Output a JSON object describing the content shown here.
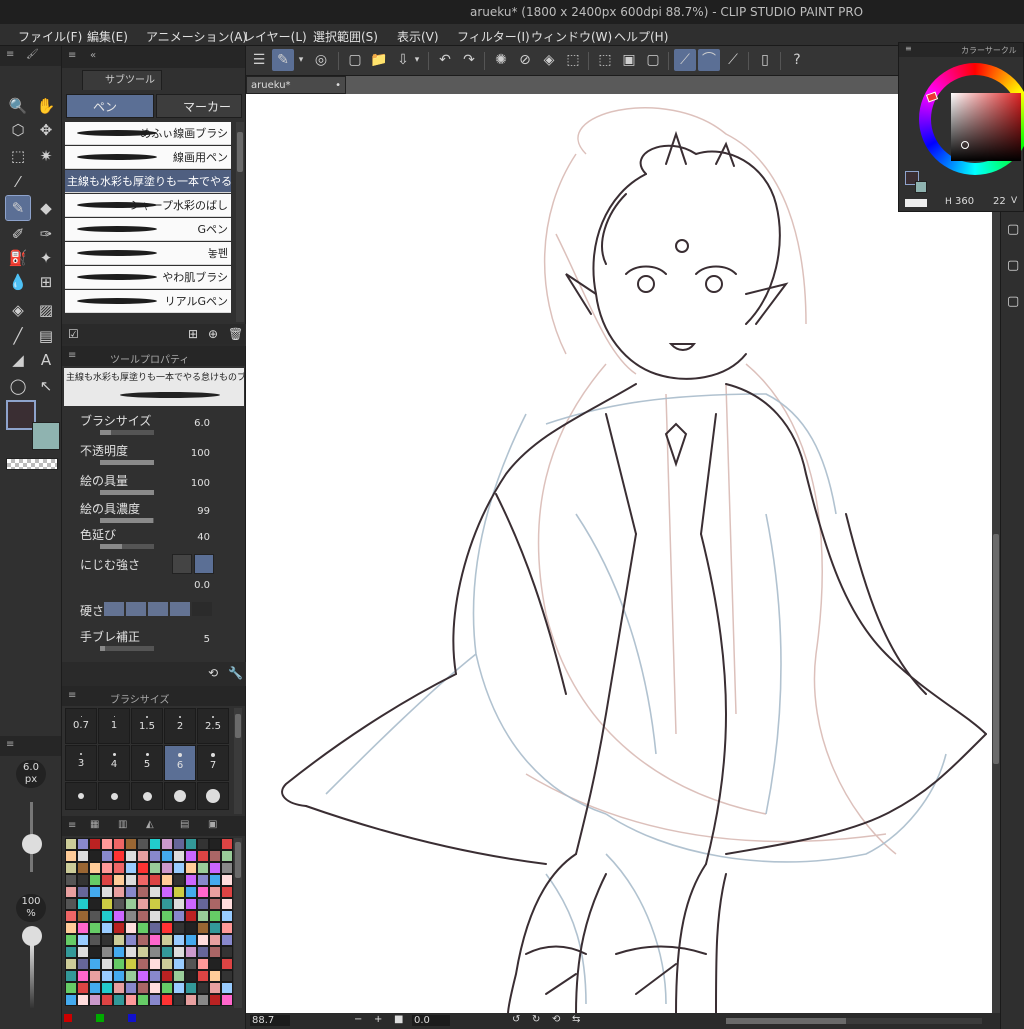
{
  "window": {
    "title": "arueku* (1800 x 2400px 600dpi 88.7%)  - CLIP STUDIO PAINT PRO"
  },
  "menu": [
    "ファイル(F)",
    "編集(E)",
    "アニメーション(A)",
    "レイヤー(L)",
    "選択範囲(S)",
    "表示(V)",
    "フィルター(I)",
    "ウィンドウ(W)",
    "ヘルプ(H)"
  ],
  "subtool": {
    "panel_title": "サブツール",
    "tabs": [
      "ペン",
      "マーカー"
    ],
    "brushes": [
      {
        "label": "めふぃ線画ブラシ",
        "selected": false
      },
      {
        "label": "線画用ペン",
        "selected": false
      },
      {
        "label": "主線も水彩も厚塗りも一本でやる",
        "selected": true
      },
      {
        "label": "シャープ水彩のばし",
        "selected": false
      },
      {
        "label": "Gペン",
        "selected": false
      },
      {
        "label": "놓펜",
        "selected": false
      },
      {
        "label": "やわ肌ブラシ",
        "selected": false
      },
      {
        "label": "リアルGペン",
        "selected": false
      }
    ]
  },
  "toolprop": {
    "panel_title": "ツールプロパティ",
    "brush_name": "主線も水彩も厚塗りも一本でやる怠けものブラシ",
    "rows": [
      {
        "label": "ブラシサイズ",
        "value": "6.0",
        "fill": 0.2
      },
      {
        "label": "不透明度",
        "value": "100",
        "fill": 1.0
      },
      {
        "label": "絵の具量",
        "value": "100",
        "fill": 1.0
      },
      {
        "label": "絵の具濃度",
        "value": "99",
        "fill": 0.99
      },
      {
        "label": "色延び",
        "value": "40",
        "fill": 0.4
      },
      {
        "label": "にじむ強さ",
        "value": "0.0",
        "fill": 0.0
      },
      {
        "label": "硬さ",
        "value": "",
        "fill": 0.0
      },
      {
        "label": "手ブレ補正",
        "value": "5",
        "fill": 0.1
      }
    ]
  },
  "brushsize": {
    "panel_title": "ブラシサイズ",
    "sizes": [
      "0.7",
      "1",
      "1.5",
      "2",
      "2.5",
      "3",
      "4",
      "5",
      "6",
      "7"
    ],
    "selected": "6"
  },
  "left_slider": {
    "size": "6.0",
    "unit": "px",
    "opacity": "100",
    "opacity_unit": "%"
  },
  "document": {
    "tab": "arueku*"
  },
  "status": {
    "zoom": "88.7",
    "angle": "0.0"
  },
  "color_circle": {
    "panel_title": "カラーサークル",
    "hue": "360",
    "value": "22",
    "v_label": "V"
  },
  "colors": {
    "main": "#3a2e33",
    "sub": "#8fb3b0",
    "accent": "#5b6f95"
  }
}
